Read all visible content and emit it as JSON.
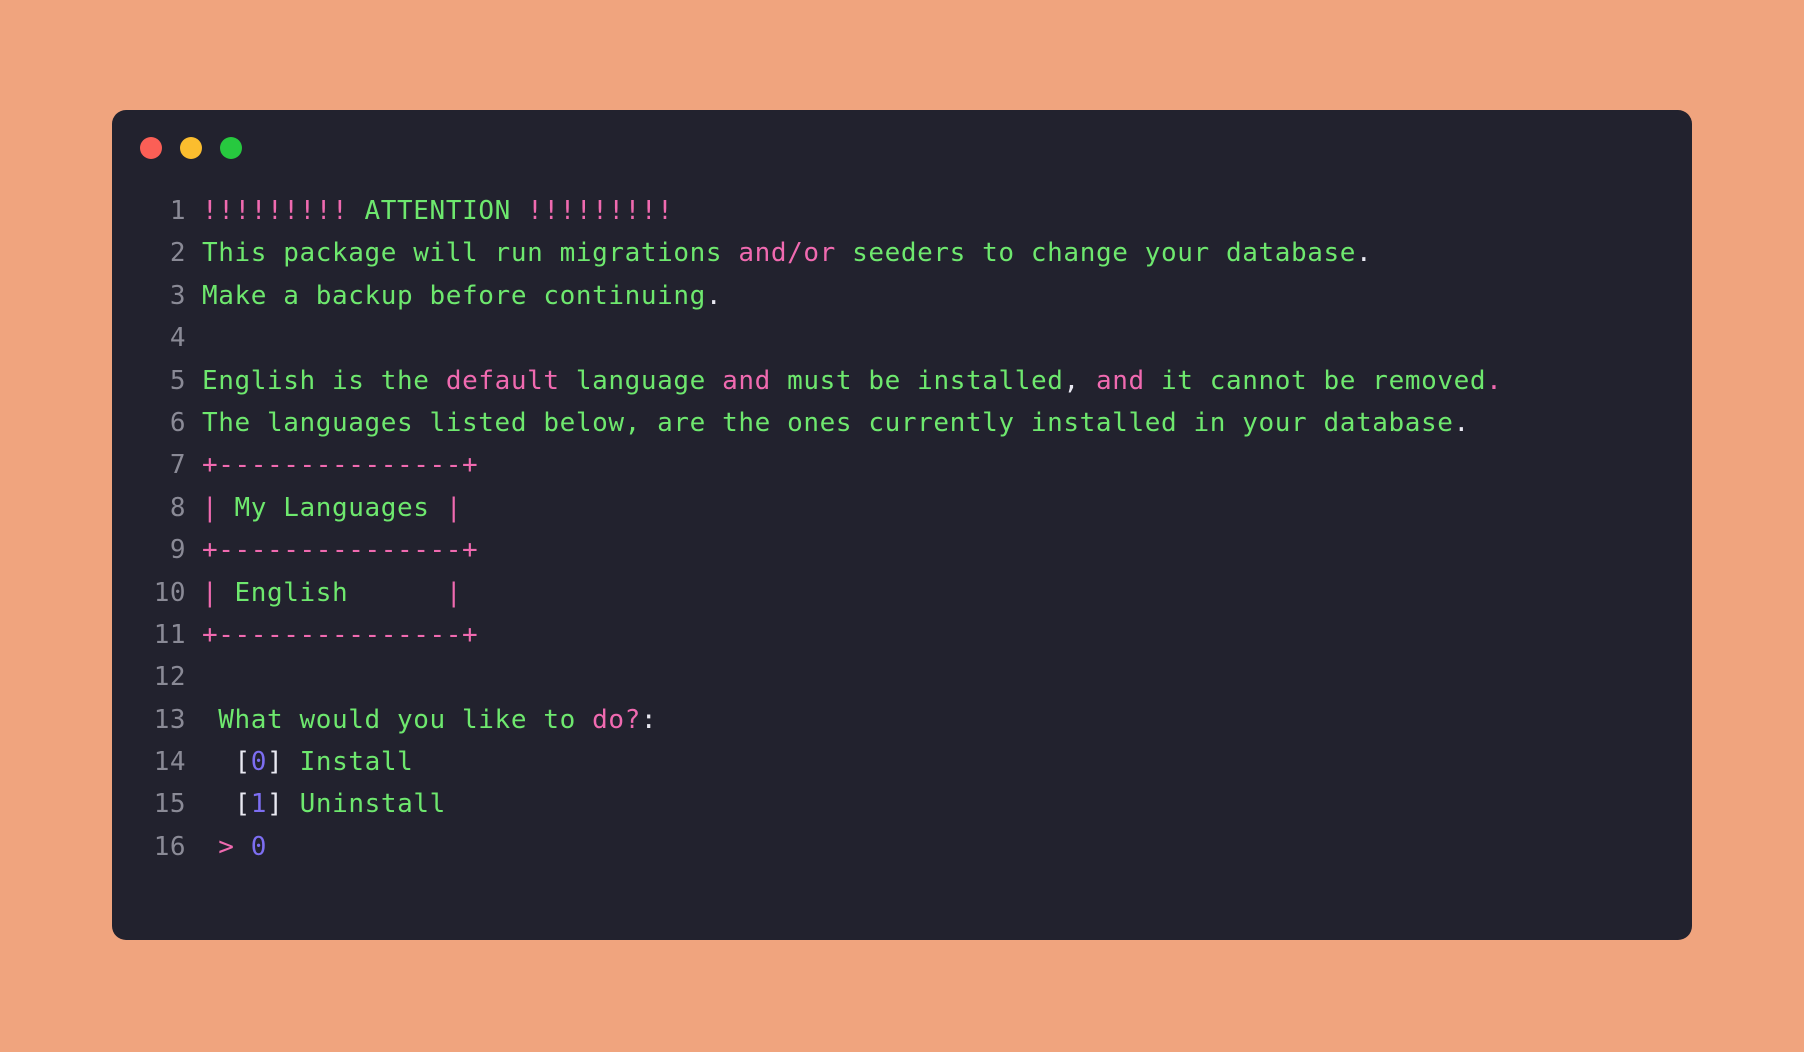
{
  "desktop": {
    "background_color": "#f0a47e"
  },
  "window": {
    "background_color": "#22222e",
    "controls": {
      "close_label": "close-window",
      "minimize_label": "minimize-window",
      "maximize_label": "maximize-window",
      "close_color": "#fb5f56",
      "minimize_color": "#fbbd2e",
      "maximize_color": "#27c93f"
    }
  },
  "theme": {
    "green": "#6ee86e",
    "pink": "#f06ab0",
    "white": "#e9e9f2",
    "purple": "#7d6ef2",
    "linenumber": "#8a8a96"
  },
  "terminal": {
    "line_numbers": [
      "1",
      "2",
      "3",
      "4",
      "5",
      "6",
      "7",
      "8",
      "9",
      "10",
      "11",
      "12",
      "13",
      "14",
      "15",
      "16"
    ],
    "lines": [
      {
        "number": "1",
        "text": "!!!!!!!!! ATTENTION !!!!!!!!!",
        "tokens": [
          {
            "t": "!!!!!!!!! ",
            "c": "p"
          },
          {
            "t": "ATTENTION",
            "c": "g"
          },
          {
            "t": " !!!!!!!!!",
            "c": "p"
          }
        ]
      },
      {
        "number": "2",
        "text": "This package will run migrations and/or seeders to change your database.",
        "tokens": [
          {
            "t": "This package will run migrations ",
            "c": "g"
          },
          {
            "t": "and/or",
            "c": "p"
          },
          {
            "t": " seeders to change your database",
            "c": "g"
          },
          {
            "t": ".",
            "c": "w"
          }
        ]
      },
      {
        "number": "3",
        "text": "Make a backup before continuing.",
        "tokens": [
          {
            "t": "Make a backup before continuing",
            "c": "g"
          },
          {
            "t": ".",
            "c": "w"
          }
        ]
      },
      {
        "number": "4",
        "text": "",
        "tokens": []
      },
      {
        "number": "5",
        "text": "English is the default language and must be installed, and it cannot be removed.",
        "tokens": [
          {
            "t": "English is the ",
            "c": "g"
          },
          {
            "t": "default",
            "c": "p"
          },
          {
            "t": " language ",
            "c": "g"
          },
          {
            "t": "and",
            "c": "p"
          },
          {
            "t": " must be installed",
            "c": "g"
          },
          {
            "t": ",",
            "c": "w"
          },
          {
            "t": " ",
            "c": "g"
          },
          {
            "t": "and",
            "c": "p"
          },
          {
            "t": " it cannot be removed",
            "c": "g"
          },
          {
            "t": ".",
            "c": "p"
          }
        ]
      },
      {
        "number": "6",
        "text": "The languages listed below, are the ones currently installed in your database.",
        "tokens": [
          {
            "t": "The languages listed below, are the ones currently installed in your database",
            "c": "g"
          },
          {
            "t": ".",
            "c": "w"
          }
        ]
      },
      {
        "number": "7",
        "text": "+---------------+",
        "tokens": [
          {
            "t": "+---------------+",
            "c": "p"
          }
        ]
      },
      {
        "number": "8",
        "text": "| My Languages |",
        "tokens": [
          {
            "t": "|",
            "c": "p"
          },
          {
            "t": " My Languages ",
            "c": "g"
          },
          {
            "t": "|",
            "c": "p"
          }
        ]
      },
      {
        "number": "9",
        "text": "+---------------+",
        "tokens": [
          {
            "t": "+---------------+",
            "c": "p"
          }
        ]
      },
      {
        "number": "10",
        "text": "| English       |",
        "tokens": [
          {
            "t": "|",
            "c": "p"
          },
          {
            "t": " English      ",
            "c": "g"
          },
          {
            "t": "|",
            "c": "p"
          }
        ]
      },
      {
        "number": "11",
        "text": "+---------------+",
        "tokens": [
          {
            "t": "+---------------+",
            "c": "p"
          }
        ]
      },
      {
        "number": "12",
        "text": "",
        "tokens": []
      },
      {
        "number": "13",
        "text": " What would you like to do?:",
        "tokens": [
          {
            "t": " What would you like to ",
            "c": "g"
          },
          {
            "t": "do?",
            "c": "p"
          },
          {
            "t": ":",
            "c": "w"
          }
        ]
      },
      {
        "number": "14",
        "text": "  [0] Install",
        "tokens": [
          {
            "t": "  ",
            "c": "g"
          },
          {
            "t": "[",
            "c": "w"
          },
          {
            "t": "0",
            "c": "v"
          },
          {
            "t": "]",
            "c": "w"
          },
          {
            "t": " Install",
            "c": "g"
          }
        ]
      },
      {
        "number": "15",
        "text": "  [1] Uninstall",
        "tokens": [
          {
            "t": "  ",
            "c": "g"
          },
          {
            "t": "[",
            "c": "w"
          },
          {
            "t": "1",
            "c": "v"
          },
          {
            "t": "]",
            "c": "w"
          },
          {
            "t": " Uninstall",
            "c": "g"
          }
        ]
      },
      {
        "number": "16",
        "text": " > 0",
        "tokens": [
          {
            "t": " ",
            "c": "g"
          },
          {
            "t": ">",
            "c": "p"
          },
          {
            "t": " ",
            "c": "g"
          },
          {
            "t": "0",
            "c": "v"
          }
        ]
      }
    ],
    "table": {
      "header": "My Languages",
      "rows": [
        "English"
      ]
    },
    "prompt": {
      "question": "What would you like to do?:",
      "options": [
        {
          "key": "0",
          "label": "Install"
        },
        {
          "key": "1",
          "label": "Uninstall"
        }
      ],
      "answer": "0",
      "symbol": ">"
    }
  }
}
